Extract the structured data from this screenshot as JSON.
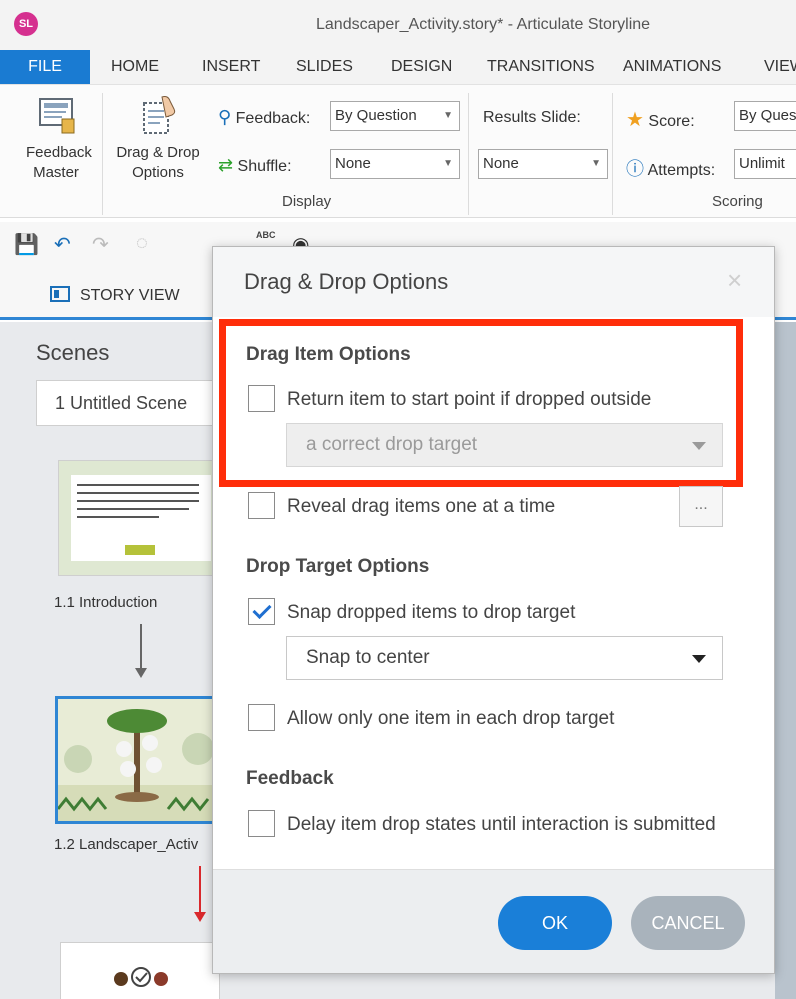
{
  "window": {
    "app_logo": "SL",
    "title": "Landscaper_Activity.story* - Articulate Storyline"
  },
  "ribbon_tabs": [
    "FILE",
    "HOME",
    "INSERT",
    "SLIDES",
    "DESIGN",
    "TRANSITIONS",
    "ANIMATIONS",
    "VIEW"
  ],
  "ribbon": {
    "feedback_master": "Feedback Master",
    "drag_drop_options": "Drag & Drop Options",
    "feedback_label": "Feedback:",
    "feedback_value": "By Question",
    "shuffle_label": "Shuffle:",
    "shuffle_value": "None",
    "results_slide_label": "Results Slide:",
    "results_slide_value": "None",
    "score_label": "Score:",
    "score_value": "By Ques",
    "attempts_label": "Attempts:",
    "attempts_value": "Unlimit",
    "group_display": "Display",
    "group_scoring": "Scoring"
  },
  "qat": {
    "icons": [
      "save-icon",
      "undo-icon",
      "redo-icon",
      "spell-check-icon",
      "find-icon"
    ],
    "spell_text": "ABC"
  },
  "view_tab": "STORY VIEW",
  "scenes": {
    "title": "Scenes",
    "selected_scene": "1 Untitled Scene",
    "slides": [
      {
        "caption": "1.1 Introduction"
      },
      {
        "caption": "1.2 Landscaper_Activ"
      }
    ]
  },
  "dialog": {
    "title": "Drag & Drop Options",
    "close_glyph": "×",
    "drag_item_options_title": "Drag Item Options",
    "return_item_label": "Return item to start point if dropped outside",
    "return_item_checked": false,
    "return_target_value": "a correct drop target",
    "reveal_label": "Reveal drag items one at a time",
    "reveal_checked": false,
    "ellipsis": "...",
    "drop_target_options_title": "Drop Target Options",
    "snap_label": "Snap dropped items to drop target",
    "snap_checked": true,
    "snap_value": "Snap to center",
    "one_item_label": "Allow only one item in each drop target",
    "one_item_checked": false,
    "feedback_title": "Feedback",
    "delay_label": "Delay item drop states until interaction is submitted",
    "delay_checked": false,
    "ok_label": "OK",
    "cancel_label": "CANCEL"
  },
  "colors": {
    "accent": "#1a7bd2",
    "highlight": "#ff2d0a",
    "cancel": "#a9b3bc"
  }
}
